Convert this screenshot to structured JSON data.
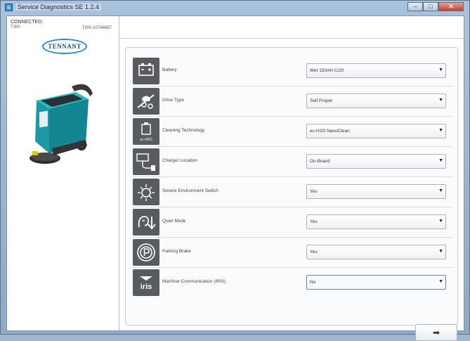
{
  "window": {
    "title": "Service Diagnostics SE 1.2.4",
    "controls": [
      "–",
      "□",
      "✕"
    ]
  },
  "connection": {
    "status_label": "CONNECTED:",
    "model": "T300",
    "serial": "T300-10746687",
    "brand_logo": "TENNANT"
  },
  "settings": [
    {
      "label": "Battery",
      "value": "Wet 150AH C/20",
      "icon": "battery-icon"
    },
    {
      "label": "Drive Type",
      "value": "Self Propel",
      "icon": "drive-type-icon"
    },
    {
      "label": "Cleaning Technology",
      "value": "ec-H2O NanoClean",
      "icon": "cleaning-technology-icon",
      "icon_caption": "ec-H2O"
    },
    {
      "label": "Charger Location",
      "value": "On-Board",
      "icon": "charger-icon"
    },
    {
      "label": "Severe Environment Switch",
      "value": "Yes",
      "icon": "severe-environment-icon"
    },
    {
      "label": "Quiet Mode",
      "value": "Yes",
      "icon": "quiet-mode-icon"
    },
    {
      "label": "Parking Brake",
      "value": "Yes",
      "icon": "parking-brake-icon"
    },
    {
      "label": "Machine Communication (IRIS)",
      "value": "No",
      "icon": "iris-icon",
      "icon_caption": "iris"
    }
  ],
  "next_button": {
    "symbol": "➡"
  }
}
